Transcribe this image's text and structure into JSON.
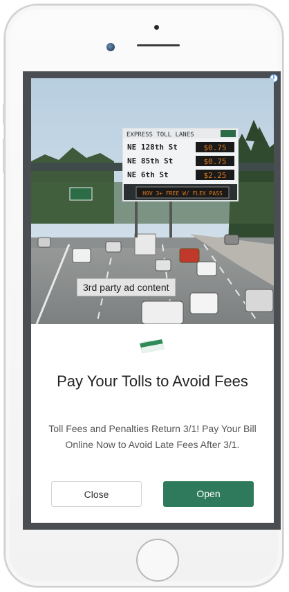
{
  "ad": {
    "overlay_label": "3rd party ad content",
    "title": "Pay Your Tolls to Avoid Fees",
    "body": "Toll Fees and Penalties Return 3/1! Pay Your Bill Online Now to Avoid Late Fees After 3/1.",
    "close_label": "Close",
    "open_label": "Open",
    "info_glyph": "i"
  },
  "toll_sign": {
    "header": "EXPRESS TOLL LANES",
    "rows": [
      {
        "street": "NE 128th St",
        "price": "$0.75"
      },
      {
        "street": "NE 85th St",
        "price": "$0.75"
      },
      {
        "street": "NE 6th St",
        "price": "$2.25"
      }
    ],
    "footer": "HOV 3+ FREE W/ FLEX PASS"
  },
  "colors": {
    "open_button": "#2f7a5c",
    "sign_green": "#2b6b45",
    "price_amber": "#e07a1a"
  },
  "icons": {
    "info": "info-icon",
    "logo": "toll-pass-logo"
  }
}
